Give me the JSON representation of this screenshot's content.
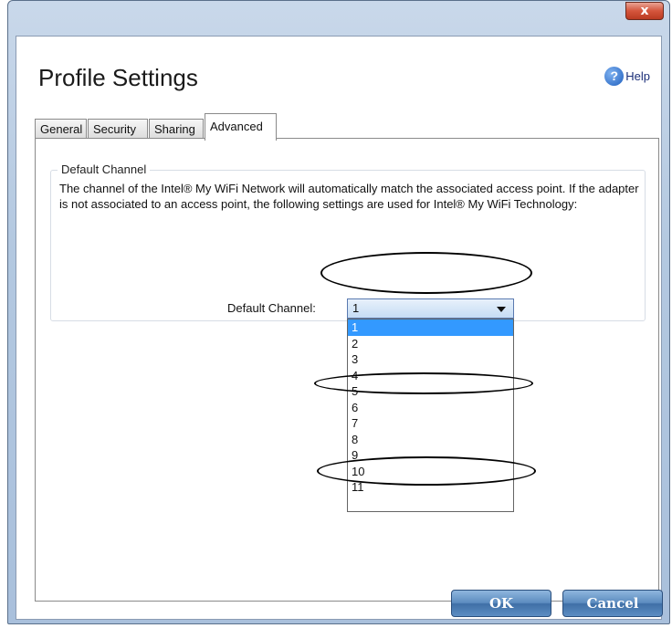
{
  "window": {
    "close_label": "x"
  },
  "header": {
    "title": "Profile Settings",
    "help_label": "Help",
    "help_icon": "help-question-icon"
  },
  "tabs": [
    {
      "label": "General"
    },
    {
      "label": "Security"
    },
    {
      "label": "Sharing"
    },
    {
      "label": "Advanced",
      "active": true
    }
  ],
  "group": {
    "legend": "Default Channel",
    "description": "The channel of the Intel® My WiFi Network will automatically match the associated access point. If the adapter is not associated to an access point, the following settings are used for Intel® My WiFi Technology:",
    "field_label": "Default Channel:",
    "selected_value": "1",
    "options": [
      "1",
      "2",
      "3",
      "4",
      "5",
      "6",
      "7",
      "8",
      "9",
      "10",
      "11"
    ]
  },
  "footer": {
    "ok_label": "OK",
    "cancel_label": "Cancel"
  },
  "colors": {
    "selection": "#3399ff",
    "button": "#4f7fb5",
    "close": "#c9452b"
  }
}
